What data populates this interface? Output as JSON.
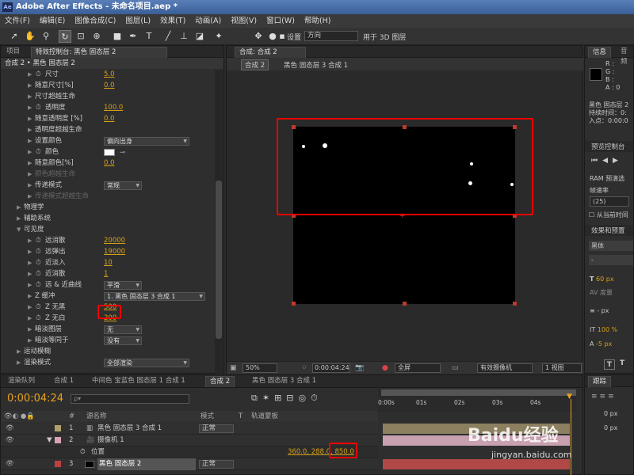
{
  "title": "Adobe After Effects - 未命名项目.aep *",
  "logo": "Ae",
  "menu": [
    "文件(F)",
    "编辑(E)",
    "图像合成(C)",
    "图层(L)",
    "效果(T)",
    "动画(A)",
    "视图(V)",
    "窗口(W)",
    "帮助(H)"
  ],
  "toolbar": {
    "settings_label": "设置",
    "direction_value": "方向",
    "use_3d_label": "用于 3D 图层"
  },
  "left_panel": {
    "tabs": [
      "项目",
      "特效控制台: 黑色 固态层 2"
    ],
    "header": "合成 2 • 黑色 固态层 2",
    "rows": [
      {
        "label": "尺寸",
        "value": "5.0",
        "indent": 2,
        "sw": true
      },
      {
        "label": "随意尺寸[%]",
        "value": "0.0",
        "indent": 1,
        "sw": false
      },
      {
        "label": "尺寸超越生命",
        "indent": 1
      },
      {
        "label": "透明度",
        "value": "100.0",
        "indent": 2,
        "sw": true
      },
      {
        "label": "随意透明度 [%]",
        "value": "0.0",
        "indent": 1
      },
      {
        "label": "透明度超越生命",
        "indent": 1
      },
      {
        "label": "设置颜色",
        "dropdown": "偏向出身",
        "indent": 1
      },
      {
        "label": "颜色",
        "indent": 2,
        "sw": true,
        "color": true
      },
      {
        "label": "随意颜色[%]",
        "value": "0.0",
        "indent": 1
      },
      {
        "label": "颜色超越生命",
        "indent": 1,
        "dim": true
      },
      {
        "label": "传递模式",
        "dropdown": "常规",
        "indent": 1
      },
      {
        "label": "传递模式超越生命",
        "indent": 1,
        "dim": true
      },
      {
        "label": "物理学",
        "indent": 0
      },
      {
        "label": "辅助系统",
        "indent": 0
      },
      {
        "label": "可见度",
        "indent": 0,
        "open": true
      },
      {
        "label": "远消散",
        "value": "20000",
        "indent": 2,
        "sw": true
      },
      {
        "label": "远弹出",
        "value": "19000",
        "indent": 2,
        "sw": true
      },
      {
        "label": "近淡入",
        "value": "10",
        "indent": 2,
        "sw": true
      },
      {
        "label": "近消散",
        "value": "1",
        "indent": 2,
        "sw": true
      },
      {
        "label": "远 & 近曲线",
        "dropdown": "平滑",
        "indent": 2,
        "sw": true
      },
      {
        "label": "Z 缓冲",
        "dropdown": "1. 黑色 固态层 3 合成 1",
        "indent": 1
      },
      {
        "label": "Z 无黑",
        "value": "500",
        "indent": 2,
        "sw": true
      },
      {
        "label": "Z 无白",
        "value": "200",
        "indent": 2,
        "sw": true
      },
      {
        "label": "暗淡图层",
        "dropdown": "无",
        "indent": 1
      },
      {
        "label": "暗淡等同于",
        "dropdown": "没有",
        "indent": 1
      },
      {
        "label": "运动模糊",
        "indent": 0
      },
      {
        "label": "渲染模式",
        "dropdown": "全部渲染",
        "indent": 0
      }
    ]
  },
  "viewer": {
    "tab": "合成: 合成 2",
    "crumb_comp": "合成 2",
    "crumb_layer": "黑色 固态层 3 合成 1",
    "zoom": "50%",
    "timecode": "0:00:04:24",
    "resolution": "全屏",
    "camera": "有效摄像机",
    "views": "1 视图"
  },
  "right_panel": {
    "info_tab": "信息",
    "audio_tab": "音频",
    "rgb": [
      "R :",
      "G :",
      "B :",
      "A : 0"
    ],
    "info_lines": [
      "黑色 固态层 2",
      "持续时间：0:",
      "入点：0:00:0"
    ],
    "preview_tab": "预览控制台",
    "ram_preview": "RAM 预演选",
    "frame_rate_label": "帧速率",
    "frame_rate": "(25)",
    "from_current": "从当前时间",
    "effects_tab": "效果和预置",
    "font": "黑体",
    "font_size": "60 px",
    "kerning": "度量",
    "stroke": "- px",
    "scale": "100 %",
    "baseline": "-5 px"
  },
  "timeline": {
    "tabs": [
      "渲染队列",
      "合成 1",
      "中间色 宝蓝色 固态层 1 合成 1",
      "合成 2",
      "黑色 固态层 3 合成 1"
    ],
    "timecode": "0:00:04:24",
    "search_placeholder": "ρ▾",
    "columns": {
      "num": "#",
      "name": "源名称",
      "mode": "模式",
      "t": "T",
      "trkmat": "轨道蒙板"
    },
    "ruler": [
      "0:00s",
      "01s",
      "02s",
      "03s",
      "04s"
    ],
    "layers": [
      {
        "num": "1",
        "name": "黑色 固态层 3 合成 1",
        "mode": "正常",
        "color": "#b0a06a"
      },
      {
        "num": "2",
        "name": "摄像机 1",
        "mode": "",
        "color": "#d9a0b8"
      },
      {
        "num": "",
        "name": "位置",
        "mode": "",
        "prop": true,
        "value": "360.0, 288.0, 850.0"
      },
      {
        "num": "3",
        "name": "黑色 固态层 2",
        "mode": "正常",
        "color": "#c04040"
      }
    ],
    "track_tab": "跟踪"
  },
  "watermark": {
    "brand": "Baidu经验",
    "url": "jingyan.baidu.com"
  }
}
